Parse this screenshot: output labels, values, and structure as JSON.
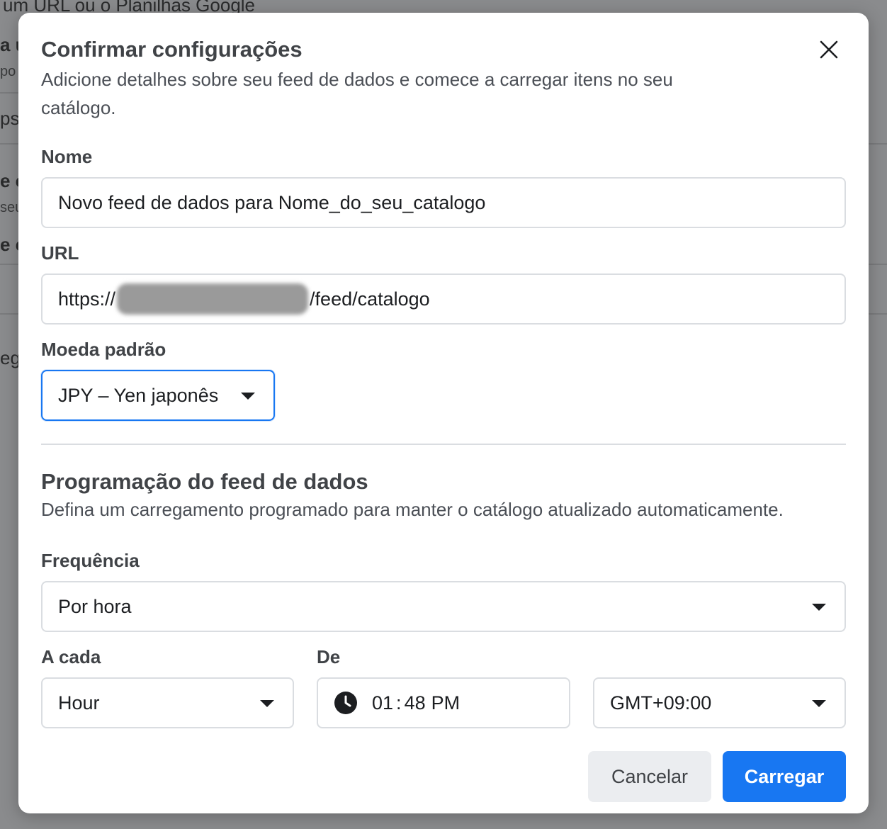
{
  "background": {
    "line1": "um URL ou o Planilhas Google",
    "fragments": [
      "a u",
      "po",
      "ps",
      "e c",
      "seu",
      "e c",
      "ega"
    ]
  },
  "modal": {
    "title": "Confirmar configurações",
    "subtitle": "Adicione detalhes sobre seu feed de dados e comece a carregar itens no seu catálogo.",
    "name_label": "Nome",
    "name_value": "Novo feed de dados para Nome_do_seu_catalogo",
    "url_label": "URL",
    "url_prefix": "https://",
    "url_suffix": "/feed/catalogo",
    "currency_label": "Moeda padrão",
    "currency_value": "JPY – Yen japonês",
    "schedule_title": "Programação do feed de dados",
    "schedule_subtitle": "Defina um carregamento programado para manter o catálogo atualizado automaticamente.",
    "frequency_label": "Frequência",
    "frequency_value": "Por hora",
    "every_label": "A cada",
    "every_value": "Hour",
    "from_label": "De",
    "time_hour": "01",
    "time_sep": ":",
    "time_minute": "48",
    "time_ampm": "PM",
    "timezone_value": "GMT+09:00",
    "cancel_label": "Cancelar",
    "submit_label": "Carregar"
  },
  "colors": {
    "accent": "#1877f2",
    "overlay": "#8a8b8d"
  }
}
